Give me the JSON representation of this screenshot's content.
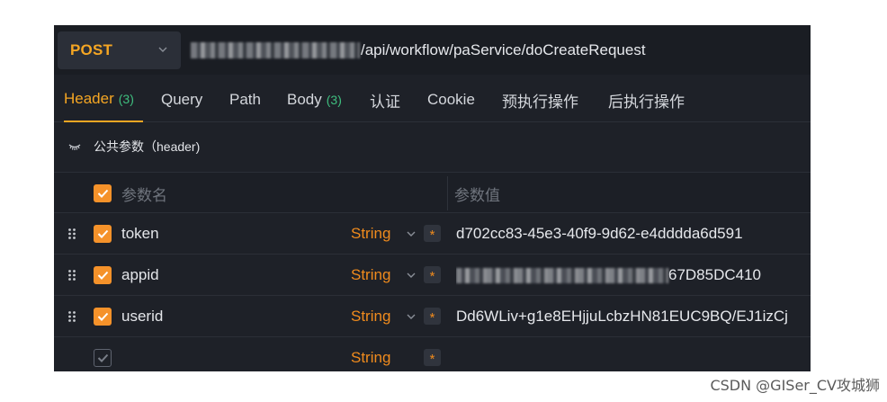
{
  "request": {
    "method": "POST",
    "url_path": "/api/workflow/paService/doCreateRequest"
  },
  "tabs": [
    {
      "label": "Header",
      "count": "(3)"
    },
    {
      "label": "Query",
      "count": ""
    },
    {
      "label": "Path",
      "count": ""
    },
    {
      "label": "Body",
      "count": "(3)"
    },
    {
      "label": "认证",
      "count": ""
    },
    {
      "label": "Cookie",
      "count": ""
    },
    {
      "label": "预执行操作",
      "count": ""
    },
    {
      "label": "后执行操作",
      "count": ""
    }
  ],
  "section": {
    "title": "公共参数（header)"
  },
  "table": {
    "headers": {
      "name": "参数名",
      "value": "参数值"
    },
    "rows": [
      {
        "name": "token",
        "type": "String",
        "required": "*",
        "value": "d702cc83-45e3-40f9-9d62-e4dddda6d591"
      },
      {
        "name": "appid",
        "type": "String",
        "required": "*",
        "value": "67D85DC410"
      },
      {
        "name": "userid",
        "type": "String",
        "required": "*",
        "value": "Dd6WLiv+g1e8EHjjuLcbzHN81EUC9BQ/EJ1izCj"
      },
      {
        "name": "",
        "type": "String",
        "required": "*",
        "value": ""
      }
    ]
  },
  "watermark": "CSDN @GISer_CV攻城狮",
  "colors": {
    "accent": "#f5a623",
    "type": "#f08b1d",
    "count": "#3fbf7f",
    "panel": "#1e2128"
  }
}
